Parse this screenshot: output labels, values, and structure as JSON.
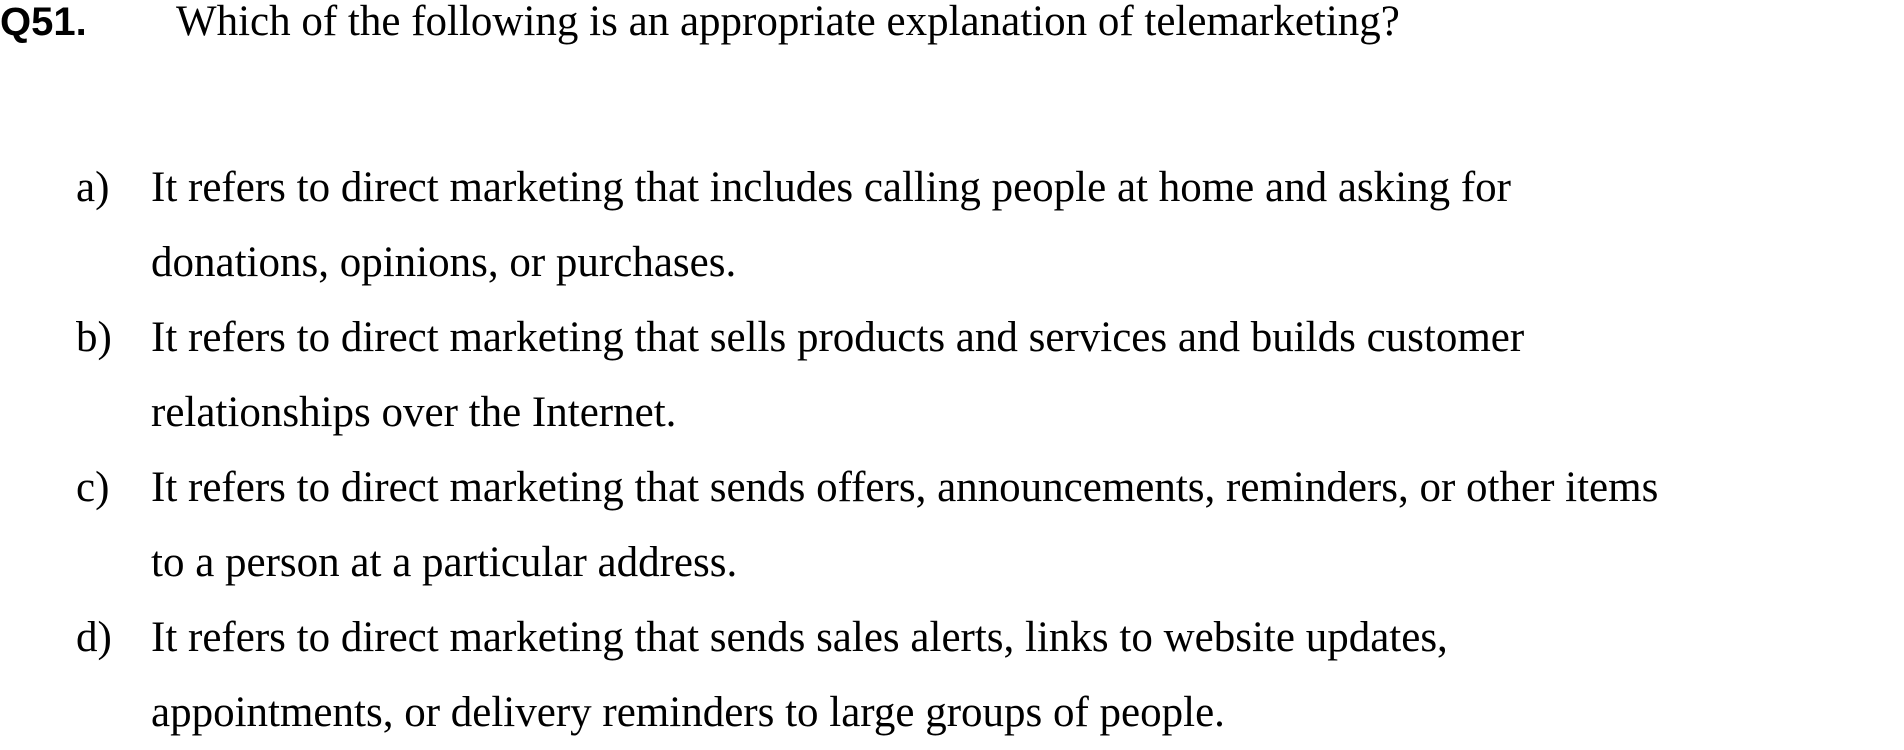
{
  "question": {
    "number": "Q51.",
    "text": "Which of the following is an appropriate explanation of telemarketing?"
  },
  "options": [
    {
      "letter": "a)",
      "lines": [
        "It refers to direct marketing that includes calling people at home and asking for",
        "donations, opinions, or purchases."
      ]
    },
    {
      "letter": "b)",
      "lines": [
        "It refers to direct marketing that sells products and services and builds customer",
        "relationships over the Internet."
      ]
    },
    {
      "letter": "c)",
      "lines": [
        "It refers to direct marketing that sends offers, announcements, reminders, or other items",
        "to a person at a particular address."
      ]
    },
    {
      "letter": "d)",
      "lines": [
        "It refers to direct marketing that sends sales alerts, links to website updates,",
        "appointments, or delivery reminders to large groups of people."
      ]
    }
  ]
}
